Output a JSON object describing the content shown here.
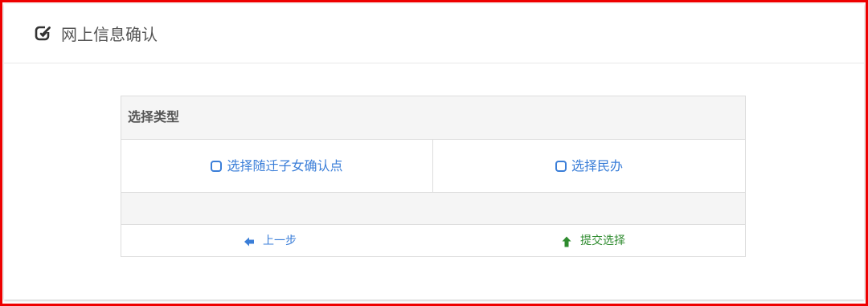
{
  "header": {
    "title": "网上信息确认",
    "icon": "edit-square-icon"
  },
  "card": {
    "heading": "选择类型",
    "options": [
      {
        "label": "选择随迁子女确认点",
        "icon": "checkbox-unchecked-icon"
      },
      {
        "label": "选择民办",
        "icon": "checkbox-unchecked-icon"
      }
    ],
    "actions": {
      "prev": {
        "label": "上一步",
        "icon": "arrow-left-icon",
        "color": "#3a7ed8"
      },
      "submit": {
        "label": "提交选择",
        "icon": "arrow-up-icon",
        "color": "#2e8b2e"
      }
    }
  },
  "colors": {
    "frame_border": "#ee0000",
    "link": "#3a7ed8",
    "success": "#2e8b2e",
    "muted_bg": "#f5f5f5"
  }
}
